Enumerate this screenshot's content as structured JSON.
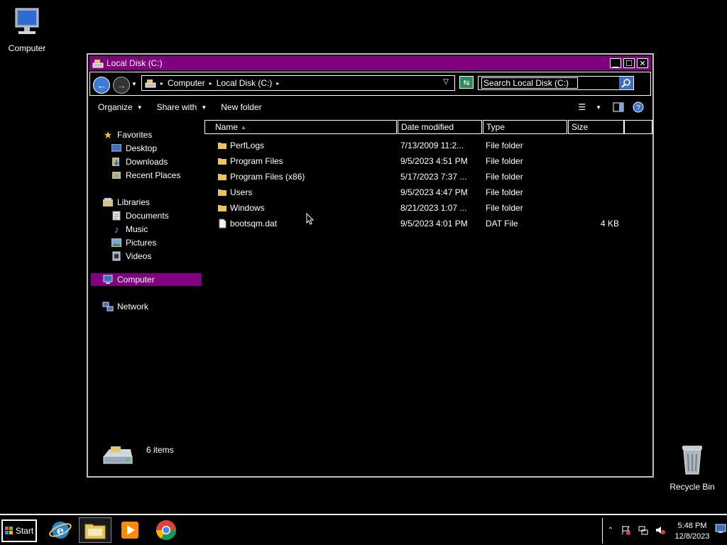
{
  "desktop": {
    "icons": [
      {
        "label": "Computer"
      },
      {
        "label": "Recycle Bin"
      }
    ]
  },
  "window": {
    "title": "Local Disk (C:)",
    "breadcrumbs": [
      "Computer",
      "Local Disk (C:)"
    ],
    "search_placeholder": "Search Local Disk (C:)",
    "toolbar": {
      "organize": "Organize",
      "share_with": "Share with",
      "new_folder": "New folder"
    },
    "nav": {
      "favorites": "Favorites",
      "favorites_items": [
        "Desktop",
        "Downloads",
        "Recent Places"
      ],
      "libraries": "Libraries",
      "libraries_items": [
        "Documents",
        "Music",
        "Pictures",
        "Videos"
      ],
      "computer": "Computer",
      "network": "Network"
    },
    "columns": {
      "name": "Name",
      "date": "Date modified",
      "type": "Type",
      "size": "Size"
    },
    "files": [
      {
        "name": "PerfLogs",
        "date": "7/13/2009 11:2...",
        "type": "File folder",
        "size": ""
      },
      {
        "name": "Program Files",
        "date": "9/5/2023 4:51 PM",
        "type": "File folder",
        "size": ""
      },
      {
        "name": "Program Files (x86)",
        "date": "5/17/2023 7:37 ...",
        "type": "File folder",
        "size": ""
      },
      {
        "name": "Users",
        "date": "9/5/2023 4:47 PM",
        "type": "File folder",
        "size": ""
      },
      {
        "name": "Windows",
        "date": "8/21/2023 1:07 ...",
        "type": "File folder",
        "size": ""
      },
      {
        "name": "bootsqm.dat",
        "date": "9/5/2023 4:01 PM",
        "type": "DAT File",
        "size": "4 KB"
      }
    ],
    "status": "6 items"
  },
  "taskbar": {
    "start": "Start",
    "clock_time": "5:48 PM",
    "clock_date": "12/8/2023"
  },
  "colors": {
    "accent": "#800080",
    "background": "#000000",
    "text": "#ffffff"
  }
}
